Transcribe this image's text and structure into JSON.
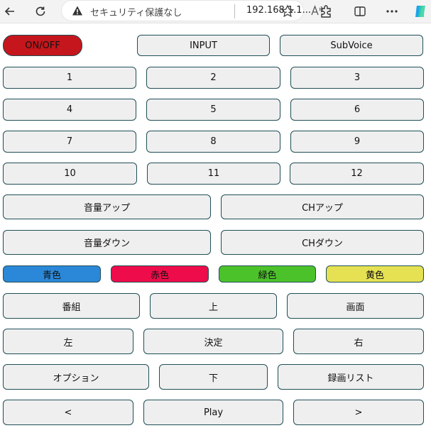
{
  "browser": {
    "security_label": "セキュリティ保護なし",
    "url": "192.168.1.1...",
    "icons": [
      "back-arrow-icon",
      "refresh-icon",
      "warning-icon",
      "read-aloud-icon",
      "favorite-star-icon",
      "extensions-icon",
      "split-screen-icon",
      "more-options-icon",
      "copilot-icon"
    ]
  },
  "remote": {
    "power": "ON/OFF",
    "input": "INPUT",
    "subvoice": "SubVoice",
    "digits": [
      "1",
      "2",
      "3",
      "4",
      "5",
      "6",
      "7",
      "8",
      "9",
      "10",
      "11",
      "12"
    ],
    "vol_up": "音量アップ",
    "ch_up": "CHアップ",
    "vol_down": "音量ダウン",
    "ch_down": "CHダウン",
    "blue": "青色",
    "red": "赤色",
    "green": "緑色",
    "yellow": "黄色",
    "program": "番組",
    "up": "上",
    "screen": "画面",
    "left": "左",
    "enter": "決定",
    "right": "右",
    "option": "オプション",
    "down": "下",
    "rec_list": "録画リスト",
    "prev": "<",
    "play": "Play",
    "next": ">"
  },
  "colors": {
    "power": "#c4161c",
    "blue": "#2b88d8",
    "red": "#ee0c4a",
    "green": "#4cc22a",
    "yellow": "#e5e153",
    "button_bg": "#efefef",
    "button_border": "#1f4f57"
  }
}
